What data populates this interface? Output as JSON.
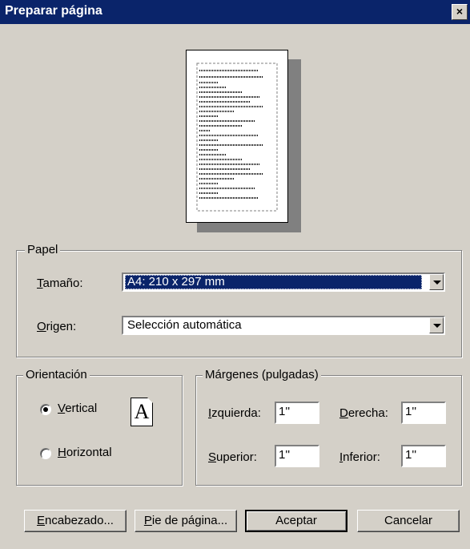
{
  "window": {
    "title": "Preparar página",
    "close_glyph": "×"
  },
  "paper": {
    "legend": "Papel",
    "size": {
      "label_u": "T",
      "label_rest": "amaño:",
      "value": "A4: 210 x 297 mm"
    },
    "source": {
      "label_u": "O",
      "label_rest": "rigen:",
      "value": "Selección automática"
    }
  },
  "orientation": {
    "legend": "Orientación",
    "vertical": {
      "label_u": "V",
      "label_rest": "ertical",
      "selected": true
    },
    "horizontal": {
      "label_u": "H",
      "label_rest": "orizontal",
      "selected": false
    },
    "icon_letter": "A"
  },
  "margins": {
    "legend": "Márgenes (pulgadas)",
    "left": {
      "label_u": "I",
      "label_rest": "zquierda:",
      "value": "1''"
    },
    "right": {
      "label_u": "D",
      "label_rest": "erecha:",
      "value": "1''"
    },
    "top": {
      "label_u": "S",
      "label_rest": "uperior:",
      "value": "1''"
    },
    "bottom": {
      "label_u": "I",
      "label_rest": "nferior:",
      "value": "1''"
    }
  },
  "buttons": {
    "header": {
      "label_u": "E",
      "label_rest": "ncabezado..."
    },
    "footer": {
      "label_u": "P",
      "label_rest": "ie de página..."
    },
    "ok": "Aceptar",
    "cancel": "Cancelar"
  }
}
